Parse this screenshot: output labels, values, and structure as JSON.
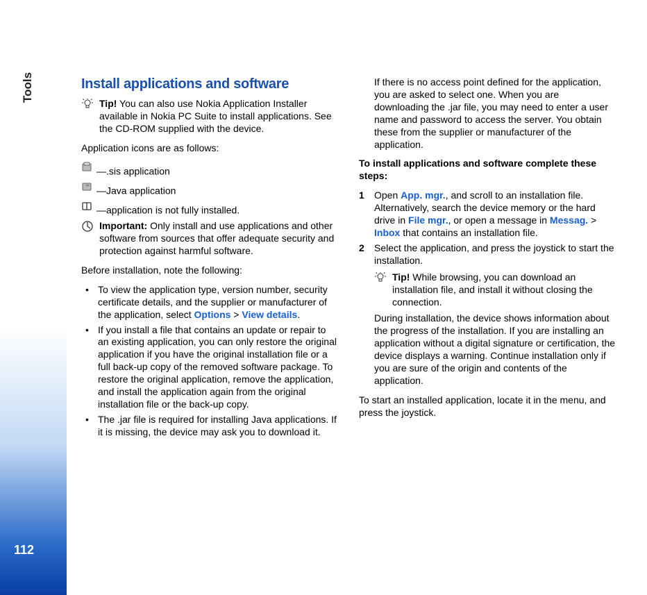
{
  "tab": "Tools",
  "page_number": "112",
  "col1": {
    "heading": "Install applications and software",
    "tip1_label": "Tip!",
    "tip1_text": " You can also use Nokia Application Installer available in Nokia PC Suite to install applications. See the CD-ROM supplied with the device.",
    "icons_intro": "Application icons are as follows:",
    "icon_sis": "—.sis application",
    "icon_java": "—Java application",
    "icon_partial": "—application is not fully installed.",
    "important_label": "Important:",
    "important_text": " Only install and use applications and other software from sources that offer adequate security and protection against harmful software.",
    "before_install": "Before installation, note the following:",
    "bullets": {
      "b1_a": "To view the application type, version number, security certificate details, and the supplier or manufacturer of the application, select ",
      "b1_link1": "Options",
      "b1_sep": " > ",
      "b1_link2": "View details",
      "b1_end": ".",
      "b2": "If you install a file that contains an update or repair to an existing application, you can only restore the original application if you have the original installation file or a full back-up copy of the removed software package. To restore the original application, remove the application, and install the application again from the original installation file or the back-up copy.",
      "b3": "The .jar file is required for installing Java applications. If it is missing, the device may ask you to download it."
    }
  },
  "col2": {
    "cont": "If there is no access point defined for the application, you are asked to select one. When you are downloading the .jar file, you may need to enter a user name and password to access the server. You obtain these from the supplier or manufacturer of the application.",
    "install_heading": "To install applications and software complete these steps:",
    "step1_a": "Open ",
    "step1_link1": "App. mgr.",
    "step1_b": ", and scroll to an installation file. Alternatively, search the device memory or the hard drive in ",
    "step1_link2": "File mgr.",
    "step1_c": ", or open a message in ",
    "step1_link3": "Messag.",
    "step1_sep": " > ",
    "step1_link4": "Inbox",
    "step1_d": " that contains an installation file.",
    "step2": "Select the application, and press the joystick to start the installation.",
    "tip2_label": "Tip!",
    "tip2_text": " While browsing, you can download an installation file, and install it without closing the connection.",
    "during": "During installation, the device shows information about the progress of the installation. If you are installing an application without a digital signature or certification, the device displays a warning. Continue installation only if you are sure of the origin and contents of the application.",
    "start_app": "To start an installed application, locate it in the menu, and press the joystick."
  }
}
